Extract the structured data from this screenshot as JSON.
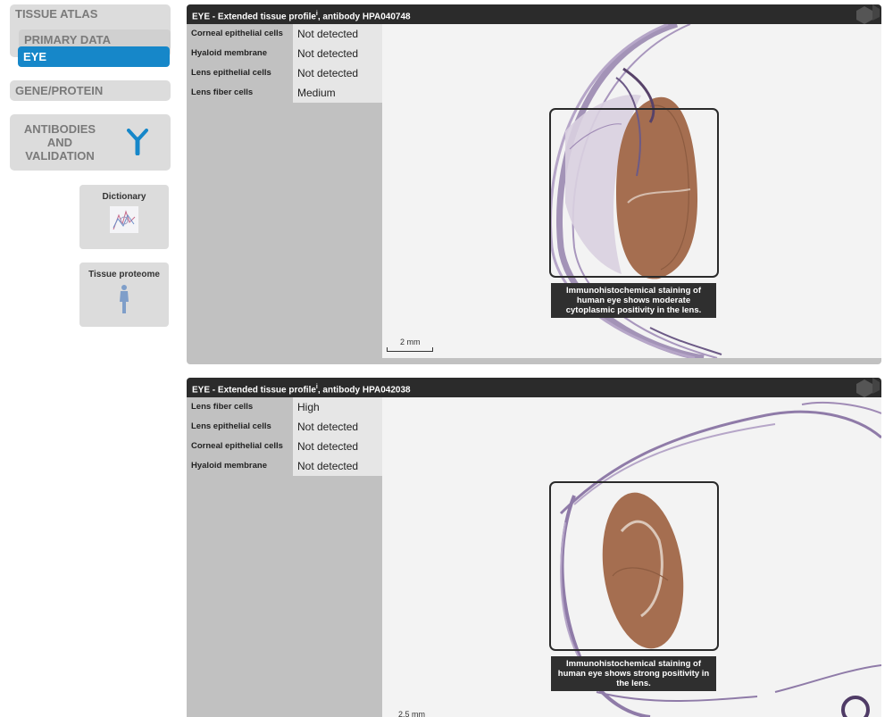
{
  "nav": {
    "tissue_atlas": "TISSUE ATLAS",
    "primary_data": "PRIMARY DATA",
    "eye": "EYE",
    "gene_protein": "GENE/PROTEIN",
    "antibodies_lines": [
      "ANTIBODIES",
      "AND",
      "VALIDATION"
    ],
    "antibodies_icon": "antibody-icon",
    "active_color": "#1687c9"
  },
  "tiles": [
    {
      "label": "Dictionary",
      "icon": "dictionary-thumbnail-icon"
    },
    {
      "label": "Tissue proteome",
      "icon": "human-body-icon"
    }
  ],
  "panels": [
    {
      "title_prefix": "EYE - Extended tissue profile",
      "title_sup": "i",
      "title_suffix": ", antibody HPA040748",
      "rows": [
        {
          "cell": "Corneal epithelial cells",
          "level": "Not detected"
        },
        {
          "cell": "Hyaloid membrane",
          "level": "Not detected"
        },
        {
          "cell": "Lens epithelial cells",
          "level": "Not detected"
        },
        {
          "cell": "Lens fiber cells",
          "level": "Medium"
        }
      ],
      "caption": "Immunohistochemical staining of human eye shows moderate cytoplasmic positivity in the lens.",
      "scale_label": "2 mm"
    },
    {
      "title_prefix": "EYE - Extended tissue profile",
      "title_sup": "i",
      "title_suffix": ", antibody HPA042038",
      "rows": [
        {
          "cell": "Lens fiber cells",
          "level": "High"
        },
        {
          "cell": "Lens epithelial cells",
          "level": "Not detected"
        },
        {
          "cell": "Corneal epithelial cells",
          "level": "Not detected"
        },
        {
          "cell": "Hyaloid membrane",
          "level": "Not detected"
        }
      ],
      "caption": "Immunohistochemical staining of human eye shows strong positivity in the lens.",
      "scale_label": "2.5 mm"
    }
  ]
}
